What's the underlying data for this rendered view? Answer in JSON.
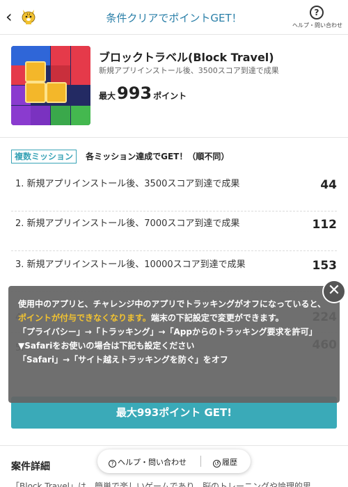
{
  "header": {
    "back_icon": "chevron-left-icon",
    "mascot_icon": "tiger-mascot-icon",
    "title": "条件クリアでポイントGET！",
    "help_label": "ヘルプ・問い合わせ"
  },
  "app": {
    "name": "ブロックトラベル(Block Travel)",
    "subtitle": "新規アプリインストール後、3500スコア到達で成果",
    "points_prefix": "最大",
    "points_value": "993",
    "points_unit": "ポイント"
  },
  "missions": {
    "badge": "複数ミッション",
    "note": "各ミッション達成でGET！（順不同）",
    "items": [
      {
        "text": "1. 新規アプリインストール後、3500スコア到達で成果",
        "points": "44"
      },
      {
        "text": "2. 新規アプリインストール後、7000スコア到達で成果",
        "points": "112"
      },
      {
        "text": "3. 新規アプリインストール後、10000スコア到達で成果",
        "points": "153"
      },
      {
        "text": "4.",
        "points": "224"
      },
      {
        "text": "5.",
        "points": "460"
      }
    ]
  },
  "cta_label": "最大993ポイント GET!",
  "details": {
    "title": "案件詳細",
    "text": "「Block Travel」は、簡単で楽しいゲームであり、脳のトレーニングや論理的思"
  },
  "float_bar": {
    "help_label": "ヘルプ・問い合わせ",
    "history_label": "履歴"
  },
  "tracking_notice": {
    "line1_a": "使用中のアプリと、チャレンジ中のアプリでトラッキングがオフになっていると、",
    "line1_highlight": "ポイントが付与できなくなります。",
    "line1_b": "端末の下記設定で変更ができます。",
    "line2": "「プライバシー」→「トラッキング」→「Appからのトラッキング要求を許可」",
    "line3": "▼Safariをお使いの場合は下記も設定ください",
    "line4": "「Safari」→「サイト越えトラッキングを防ぐ」をオフ",
    "highlight_color": "#f4c430"
  }
}
